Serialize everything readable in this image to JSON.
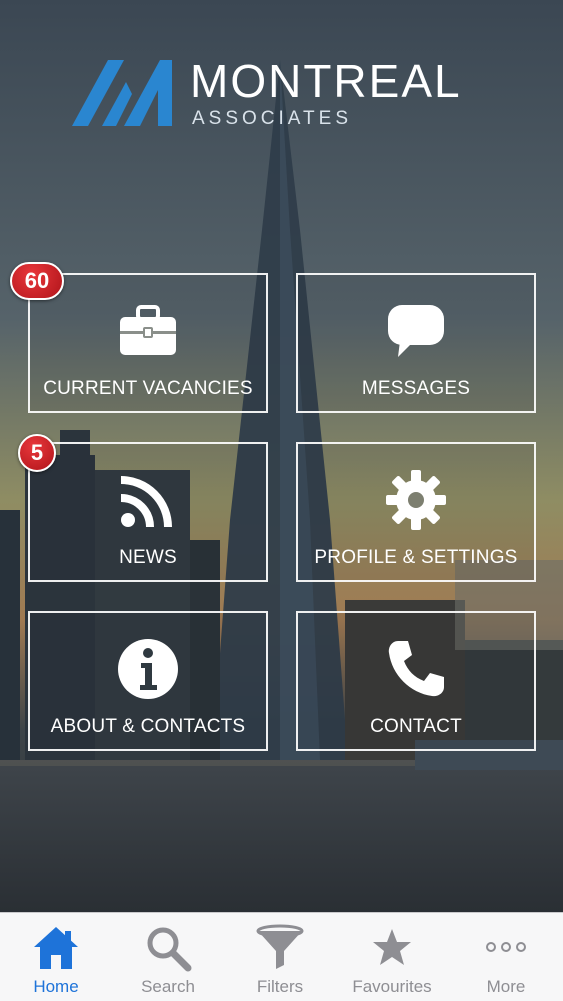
{
  "brand": {
    "title": "MONTREAL",
    "subtitle": "ASSOCIATES"
  },
  "tiles": [
    {
      "label": "CURRENT VACANCIES",
      "icon": "briefcase-icon",
      "badge": "60"
    },
    {
      "label": "MESSAGES",
      "icon": "chat-bubble-icon"
    },
    {
      "label": "NEWS",
      "icon": "rss-feed-icon",
      "badge": "5"
    },
    {
      "label": "PROFILE & SETTINGS",
      "icon": "gear-icon"
    },
    {
      "label": "ABOUT & CONTACTS",
      "icon": "info-icon"
    },
    {
      "label": "CONTACT",
      "icon": "phone-icon"
    }
  ],
  "tabbar": {
    "items": [
      {
        "label": "Home",
        "icon": "home-icon",
        "active": true
      },
      {
        "label": "Search",
        "icon": "search-icon"
      },
      {
        "label": "Filters",
        "icon": "filter-funnel-icon"
      },
      {
        "label": "Favourites",
        "icon": "star-icon"
      },
      {
        "label": "More",
        "icon": "more-dots-icon"
      }
    ]
  },
  "colors": {
    "accent": "#1e73d9",
    "logo_blue": "#2a86d0",
    "badge_red": "#d42027",
    "tab_inactive": "#8e8e93"
  }
}
